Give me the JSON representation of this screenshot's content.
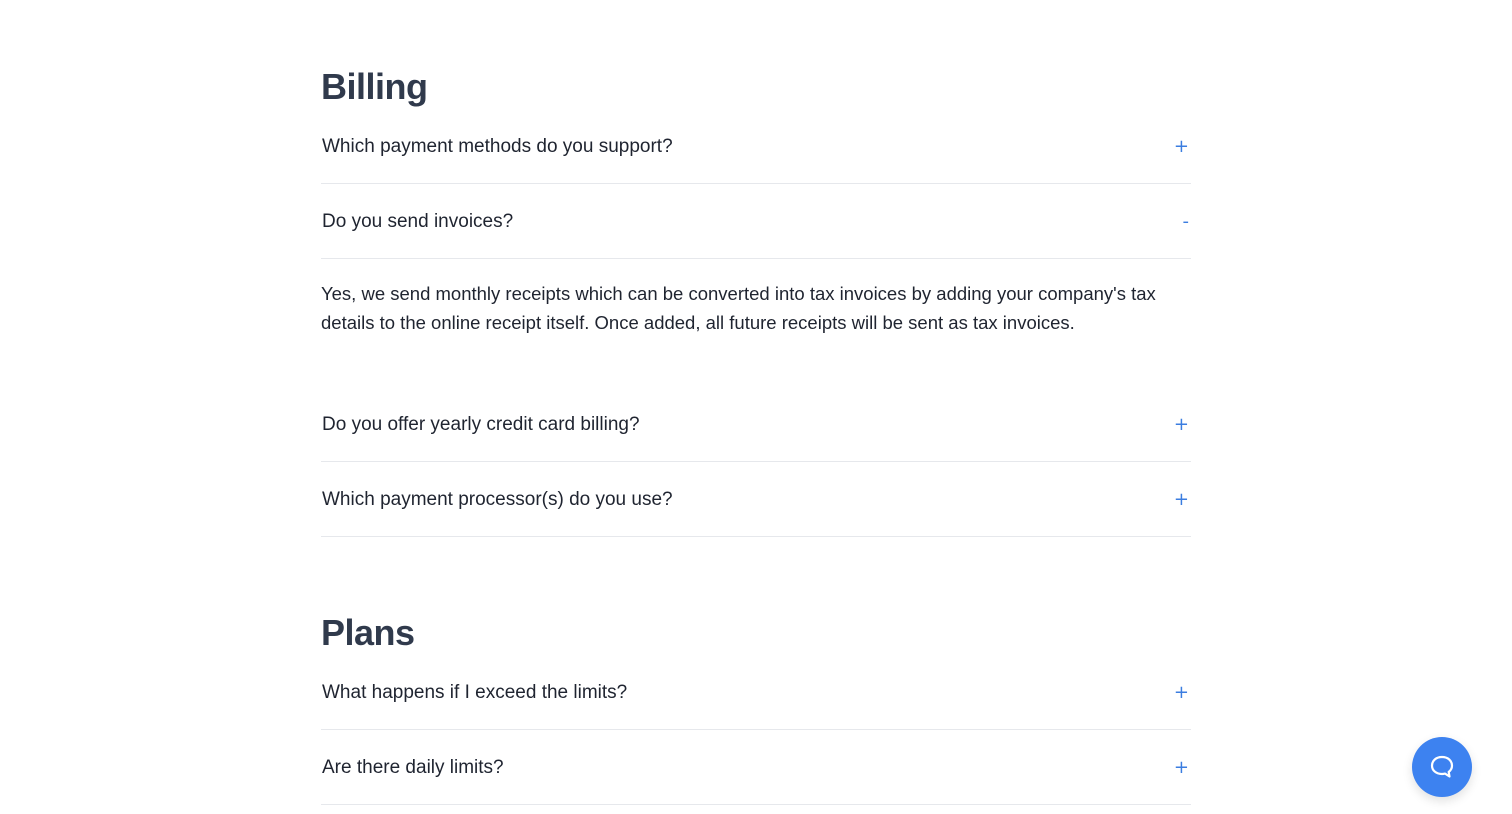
{
  "billing": {
    "title": "Billing",
    "items": [
      {
        "question": "Which payment methods do you support?",
        "toggle": "+"
      },
      {
        "question": "Do you send invoices?",
        "toggle": "-",
        "answer": "Yes, we send monthly receipts which can be converted into tax invoices by adding your company's tax details to the online receipt itself. Once added, all future receipts will be sent as tax invoices."
      },
      {
        "question": "Do you offer yearly credit card billing?",
        "toggle": "+"
      },
      {
        "question": "Which payment processor(s) do you use?",
        "toggle": "+"
      }
    ]
  },
  "plans": {
    "title": "Plans",
    "items": [
      {
        "question": "What happens if I exceed the limits?",
        "toggle": "+"
      },
      {
        "question": "Are there daily limits?",
        "toggle": "+"
      }
    ]
  },
  "chat": {
    "icon": "chat-bubble-icon",
    "accent": "#3d82f0"
  },
  "colors": {
    "heading": "#303a4c",
    "toggle": "#3b7de0",
    "divider": "#e6e8ec"
  }
}
